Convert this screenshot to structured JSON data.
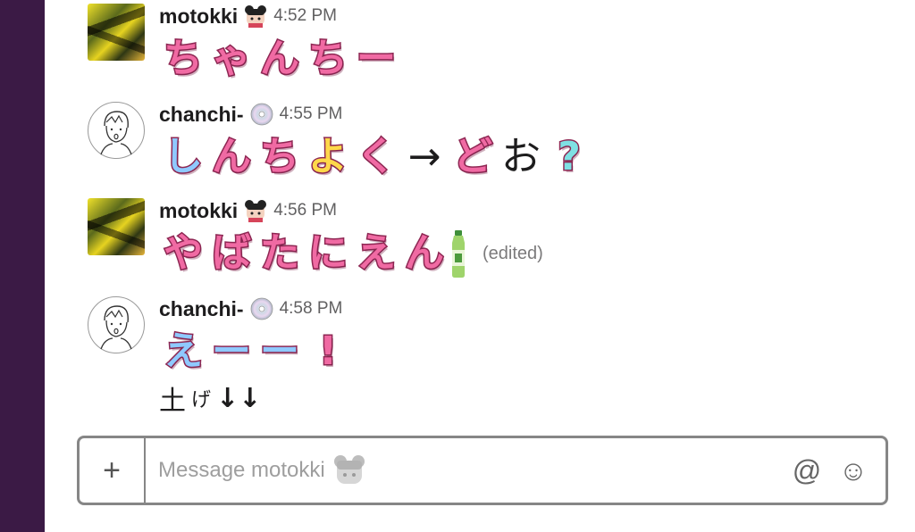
{
  "messages": [
    {
      "author": "motokki",
      "time": "4:52 PM",
      "avatar": "yellow-photo-avatar",
      "status_icon": "bear-head-icon",
      "stickers": [
        {
          "text": "ち",
          "color": "pink"
        },
        {
          "text": "ゃ",
          "color": "pink"
        },
        {
          "text": "ん",
          "color": "pink"
        },
        {
          "text": "ち",
          "color": "pink"
        },
        {
          "text": "ー",
          "color": "pink"
        }
      ]
    },
    {
      "author": "chanchi-",
      "time": "4:55 PM",
      "avatar": "sketch-avatar",
      "status_icon": "cd-icon",
      "stickers": [
        {
          "text": "し",
          "color": "blue"
        },
        {
          "text": "ん",
          "color": "pink"
        },
        {
          "text": "ち",
          "color": "pink"
        },
        {
          "text": "よ",
          "color": "yellow"
        },
        {
          "text": "く",
          "color": "pink"
        },
        {
          "text": "→",
          "color": "plain"
        },
        {
          "text": "ど",
          "color": "pink"
        },
        {
          "text": "お",
          "color": "plain"
        },
        {
          "text": "?",
          "color": "mint"
        }
      ]
    },
    {
      "author": "motokki",
      "time": "4:56 PM",
      "avatar": "yellow-photo-avatar",
      "status_icon": "bear-head-icon",
      "stickers": [
        {
          "text": "や",
          "color": "pink"
        },
        {
          "text": "ば",
          "color": "pink"
        },
        {
          "text": "た",
          "color": "pink"
        },
        {
          "text": "に",
          "color": "pink"
        },
        {
          "text": "え",
          "color": "pink"
        },
        {
          "text": "ん",
          "color": "pink"
        }
      ],
      "trailing_icon": "green-tea-bottle-icon",
      "edited": "(edited)"
    },
    {
      "author": "chanchi-",
      "time": "4:58 PM",
      "avatar": "sketch-avatar",
      "status_icon": "cd-icon",
      "stickers": [
        {
          "text": "え",
          "color": "blue"
        },
        {
          "text": "ー",
          "color": "blue"
        },
        {
          "text": "ー",
          "color": "blue"
        },
        {
          "text": "!",
          "color": "pink"
        }
      ],
      "extra_line": [
        "土",
        "げ",
        "↓↓"
      ]
    }
  ],
  "composer": {
    "placeholder": "Message motokki",
    "add_label": "+",
    "mention_label": "@",
    "emoji_label": "☺",
    "placeholder_icon": "bear-head-icon"
  },
  "colors": {
    "sidebar": "#3b1a45",
    "border": "#868686",
    "pink": "#f06aa3",
    "blue": "#8fc9ff",
    "yellow": "#ffd84a"
  }
}
